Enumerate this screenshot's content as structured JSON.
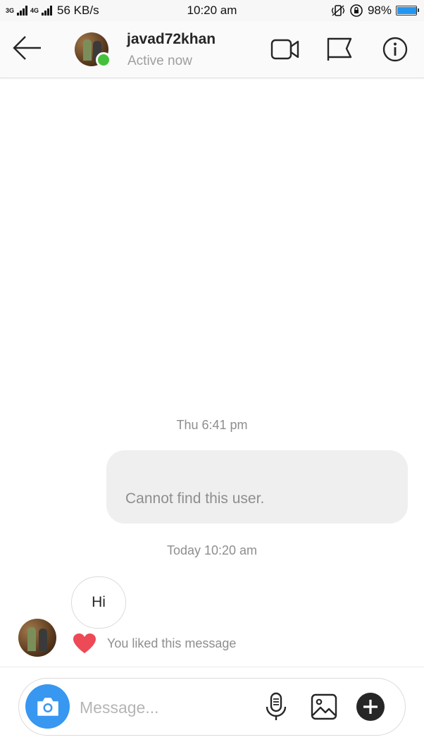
{
  "status_bar": {
    "network_left": "3G",
    "network_right": "4G",
    "speed": "56 KB/s",
    "time": "10:20 am",
    "battery": "98%",
    "battery_level": 0.98,
    "battery_color": "#2196f3"
  },
  "header": {
    "back_icon": "arrow-left-icon",
    "username": "javad72khan",
    "status": "Active now",
    "active_color": "#44c13c",
    "icons": [
      "video-call-icon",
      "flag-icon",
      "info-icon"
    ]
  },
  "conversation": {
    "timestamp_1": "Thu 6:41 pm",
    "sent_message": "Cannot find this user.",
    "timestamp_2": "Today 10:20 am",
    "received_message": "Hi",
    "reaction_icon": "heart-icon",
    "reaction_color": "#ed4956",
    "reaction_text": "You liked this message"
  },
  "composer": {
    "placeholder": "Message...",
    "value": "",
    "camera_color": "#3897f0",
    "icons": [
      "camera-icon",
      "microphone-icon",
      "gallery-icon",
      "add-icon"
    ]
  }
}
